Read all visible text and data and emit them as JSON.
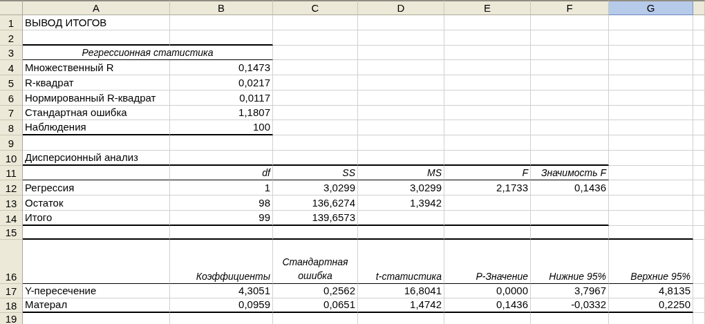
{
  "column_headers": [
    {
      "label": "A",
      "selected": false
    },
    {
      "label": "B",
      "selected": false
    },
    {
      "label": "C",
      "selected": false
    },
    {
      "label": "D",
      "selected": false
    },
    {
      "label": "E",
      "selected": false
    },
    {
      "label": "F",
      "selected": false
    },
    {
      "label": "G",
      "selected": true
    }
  ],
  "row_headers": [
    "1",
    "2",
    "3",
    "4",
    "5",
    "6",
    "7",
    "8",
    "9",
    "10",
    "11",
    "12",
    "13",
    "14",
    "15",
    "16",
    "17",
    "18",
    "19"
  ],
  "title": "ВЫВОД ИТОГОВ",
  "regression_statistics": {
    "caption": "Регрессионная статистика",
    "rows": [
      {
        "label": "Множественный R",
        "value": "0,1473"
      },
      {
        "label": "R-квадрат",
        "value": "0,0217"
      },
      {
        "label": "Нормированный R-квадрат",
        "value": "0,0117"
      },
      {
        "label": "Стандартная ошибка",
        "value": "1,1807"
      },
      {
        "label": "Наблюдения",
        "value": "100"
      }
    ]
  },
  "anova": {
    "title": "Дисперсионный анализ",
    "columns": [
      "df",
      "SS",
      "MS",
      "F",
      "Значимость F"
    ],
    "rows": [
      {
        "label": "Регрессия",
        "values": [
          "1",
          "3,0299",
          "3,0299",
          "2,1733",
          "0,1436"
        ]
      },
      {
        "label": "Остаток",
        "values": [
          "98",
          "136,6274",
          "1,3942"
        ]
      },
      {
        "label": "Итого",
        "values": [
          "99",
          "139,6573"
        ]
      }
    ]
  },
  "coefficients": {
    "columns": [
      "Коэффициенты",
      "Стандартная ошибка",
      "t-статистика",
      "P-Значение",
      "Нижние 95%",
      "Верхние 95%"
    ],
    "rows": [
      {
        "label": "Y-пересечение",
        "values": [
          "4,3051",
          "0,2562",
          "16,8041",
          "0,0000",
          "3,7967",
          "4,8135"
        ]
      },
      {
        "label": "Матерал",
        "values": [
          "0,0959",
          "0,0651",
          "1,4742",
          "0,1436",
          "-0,0332",
          "0,2250"
        ]
      }
    ]
  }
}
